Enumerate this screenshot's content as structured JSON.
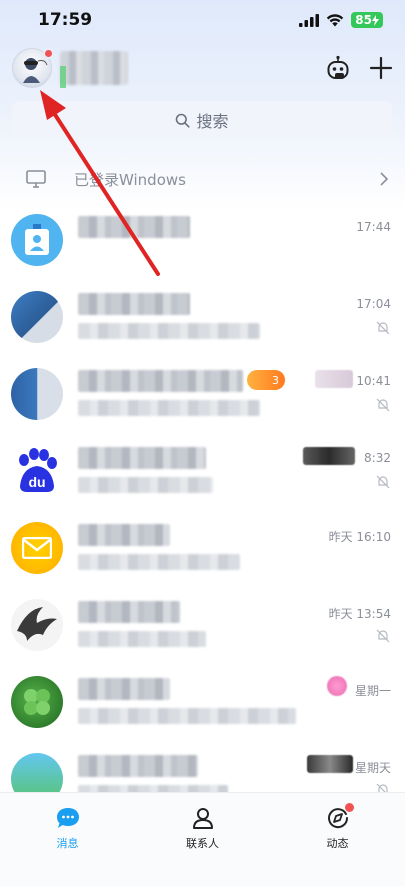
{
  "status_bar": {
    "time": "17:59",
    "battery": "85"
  },
  "header": {},
  "search": {
    "placeholder": "搜索"
  },
  "device_bar": {
    "label": "已登录Windows"
  },
  "chats": [
    {
      "time": "17:44",
      "muted": false
    },
    {
      "time": "17:04",
      "muted": true
    },
    {
      "time": "10:41",
      "muted": true,
      "badge": "3"
    },
    {
      "time": "8:32",
      "muted": true,
      "avatar_text": "du"
    },
    {
      "time": "昨天 16:10",
      "muted": false
    },
    {
      "time": "昨天 13:54",
      "muted": true
    },
    {
      "time": "星期一",
      "muted": false
    },
    {
      "time": "星期天",
      "muted": true
    }
  ],
  "tabs": [
    {
      "label": "消息",
      "active": true
    },
    {
      "label": "联系人",
      "active": false
    },
    {
      "label": "动态",
      "active": false
    }
  ],
  "colors": {
    "accent": "#1a9ef0",
    "notification_dot": "#f25252",
    "annotation_arrow": "#e02424"
  }
}
